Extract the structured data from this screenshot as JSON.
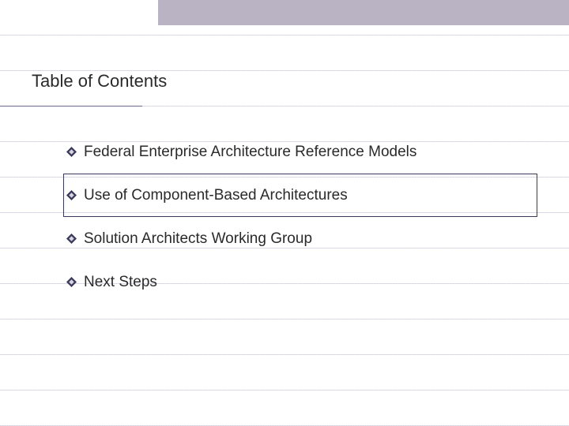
{
  "slide": {
    "title": "Table of Contents",
    "items": [
      {
        "label": "Federal Enterprise Architecture Reference Models",
        "highlighted": false
      },
      {
        "label": "Use of Component-Based Architectures",
        "highlighted": true
      },
      {
        "label": "Solution Architects Working Group",
        "highlighted": false
      },
      {
        "label": "Next Steps",
        "highlighted": false
      }
    ]
  }
}
